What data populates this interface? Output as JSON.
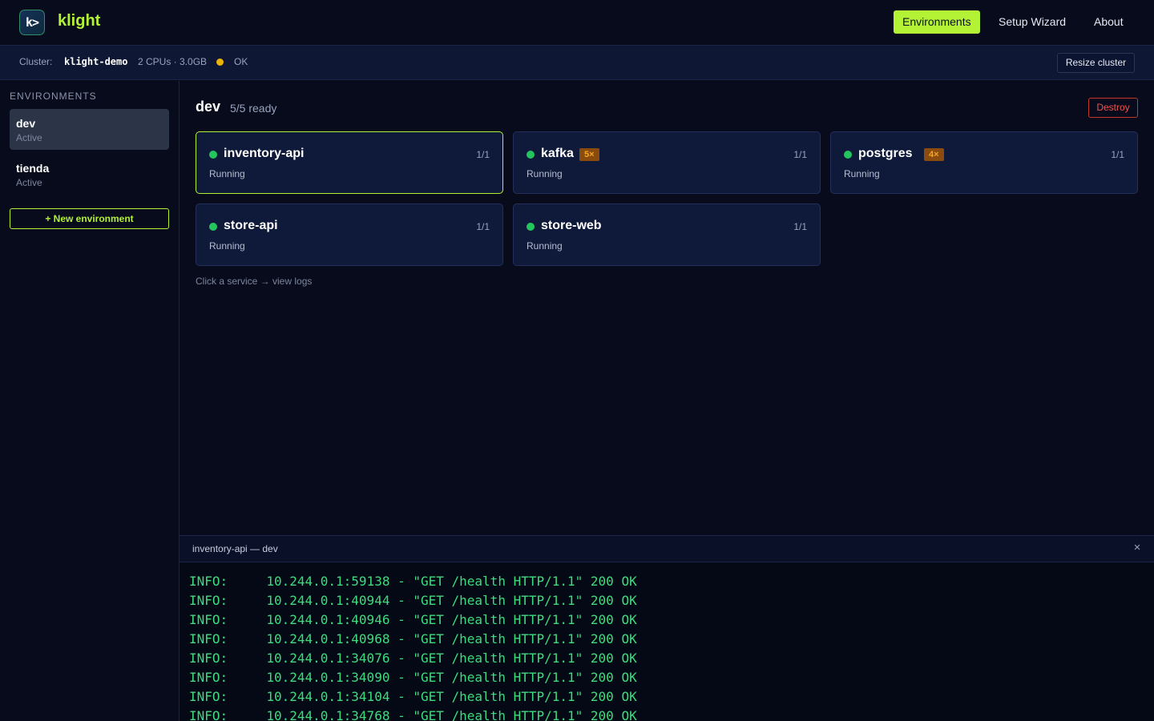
{
  "topbar": {
    "logo_glyph": "k>",
    "brand": "klight",
    "nav": [
      {
        "label": "Environments",
        "active": true
      },
      {
        "label": "Setup Wizard",
        "active": false
      },
      {
        "label": "About",
        "active": false
      }
    ]
  },
  "cluster": {
    "label": "Cluster:",
    "name": "klight-demo",
    "resources": "2 CPUs · 3.0GB",
    "status": "OK",
    "status_color": "#eab308",
    "resize_label": "Resize cluster"
  },
  "sidebar": {
    "heading": "ENVIRONMENTS",
    "items": [
      {
        "name": "dev",
        "status": "Active",
        "selected": true
      },
      {
        "name": "tienda",
        "status": "Active",
        "selected": false
      }
    ],
    "new_label": "+ New environment"
  },
  "main": {
    "env_name": "dev",
    "ready": "5/5 ready",
    "destroy_label": "Destroy",
    "services": [
      {
        "name": "inventory-api",
        "badge": "",
        "count": "1/1",
        "state": "Running",
        "selected": true
      },
      {
        "name": "kafka",
        "badge": "5×",
        "count": "1/1",
        "state": "Running",
        "selected": false
      },
      {
        "name": "postgres",
        "badge": "4×",
        "count": "1/1",
        "state": "Running",
        "selected": false
      },
      {
        "name": "store-api",
        "badge": "",
        "count": "1/1",
        "state": "Running",
        "selected": false
      },
      {
        "name": "store-web",
        "badge": "",
        "count": "1/1",
        "state": "Running",
        "selected": false
      }
    ],
    "hint": "Click a service → view logs"
  },
  "logs": {
    "title": "inventory-api — dev",
    "close_glyph": "×",
    "lines": [
      "INFO:     10.244.0.1:59138 - \"GET /health HTTP/1.1\" 200 OK",
      "INFO:     10.244.0.1:40944 - \"GET /health HTTP/1.1\" 200 OK",
      "INFO:     10.244.0.1:40946 - \"GET /health HTTP/1.1\" 200 OK",
      "INFO:     10.244.0.1:40968 - \"GET /health HTTP/1.1\" 200 OK",
      "INFO:     10.244.0.1:34076 - \"GET /health HTTP/1.1\" 200 OK",
      "INFO:     10.244.0.1:34090 - \"GET /health HTTP/1.1\" 200 OK",
      "INFO:     10.244.0.1:34104 - \"GET /health HTTP/1.1\" 200 OK",
      "INFO:     10.244.0.1:34768 - \"GET /health HTTP/1.1\" 200 OK"
    ]
  },
  "colors": {
    "accent": "#b4f236",
    "running": "#22c55e",
    "danger": "#ef5350",
    "log_text": "#3edc7f"
  }
}
